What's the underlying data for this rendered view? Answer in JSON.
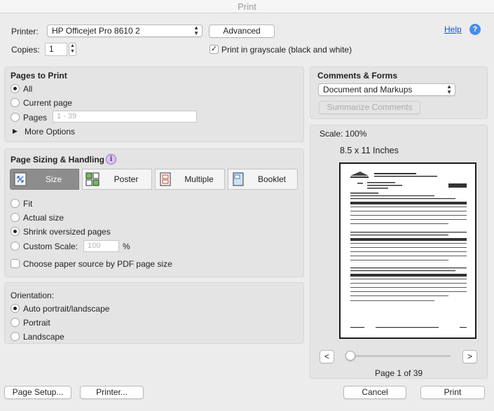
{
  "window": {
    "title": "Print"
  },
  "printer": {
    "label": "Printer:",
    "value": "HP Officejet Pro 8610 2",
    "advanced_label": "Advanced",
    "copies_label": "Copies:",
    "copies_value": "1",
    "grayscale_label": "Print in grayscale (black and white)",
    "grayscale_checked": true,
    "help_label": "Help"
  },
  "pages_to_print": {
    "heading": "Pages to Print",
    "all_label": "All",
    "current_label": "Current page",
    "pages_label": "Pages",
    "pages_placeholder": "1 - 39",
    "more_options_label": "More Options"
  },
  "sizing": {
    "heading": "Page Sizing & Handling",
    "tabs": [
      "Size",
      "Poster",
      "Multiple",
      "Booklet"
    ],
    "active_tab": "Size",
    "fit_label": "Fit",
    "actual_label": "Actual size",
    "shrink_label": "Shrink oversized pages",
    "custom_label": "Custom Scale:",
    "custom_placeholder": "100",
    "percent": "%",
    "paper_source_label": "Choose paper source by PDF page size"
  },
  "orientation": {
    "heading": "Orientation:",
    "auto_label": "Auto portrait/landscape",
    "portrait_label": "Portrait",
    "landscape_label": "Landscape"
  },
  "comments": {
    "heading": "Comments & Forms",
    "value": "Document and Markups",
    "summarize_label": "Summarize Comments"
  },
  "preview": {
    "scale_label": "Scale: 100%",
    "paper_size": "8.5 x 11 Inches",
    "prev_label": "<",
    "next_label": ">",
    "page_indicator": "Page 1 of 39",
    "slider_position": 0
  },
  "footer": {
    "page_setup_label": "Page Setup...",
    "printer_label": "Printer...",
    "cancel_label": "Cancel",
    "print_label": "Print"
  }
}
